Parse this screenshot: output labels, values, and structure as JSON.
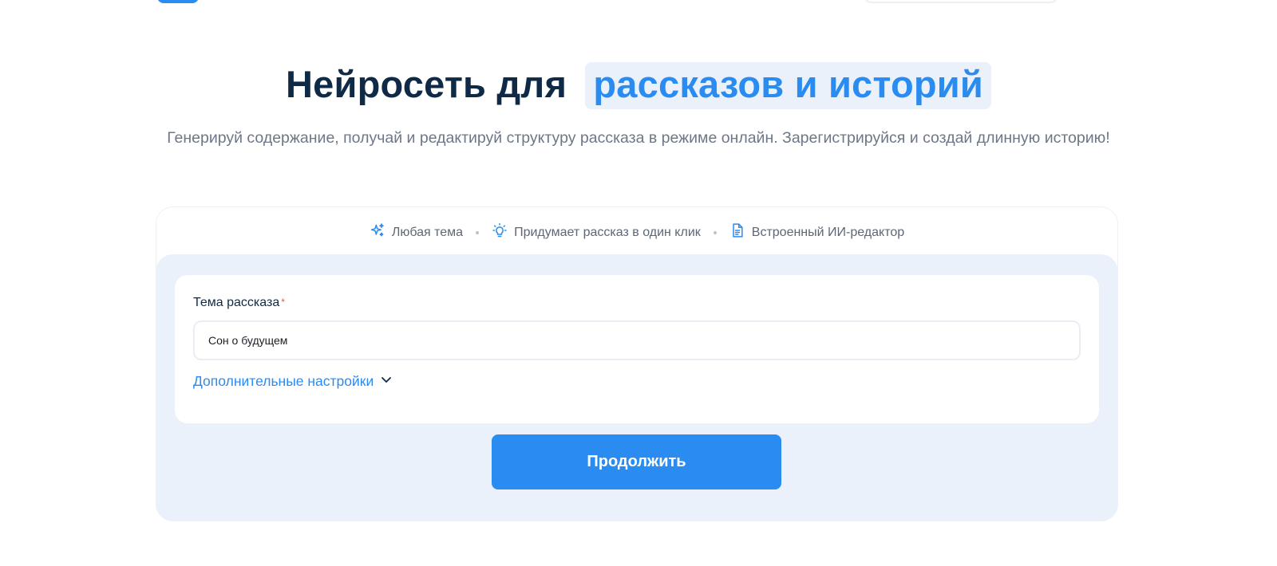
{
  "hero": {
    "title_main": "Нейросеть для",
    "title_accent": "рассказов и историй",
    "subtitle": "Генерируй содержание, получай и редактируй структуру рассказа в режиме онлайн. Зарегистрируйся и создай длинную историю!"
  },
  "features": [
    {
      "icon": "sparkles-icon",
      "label": "Любая тема"
    },
    {
      "icon": "lightbulb-icon",
      "label": "Придумает рассказ в один клик"
    },
    {
      "icon": "document-icon",
      "label": "Встроенный ИИ-редактор"
    }
  ],
  "form": {
    "topic_label": "Тема рассказа",
    "required_mark": "*",
    "topic_value": "Сон о будущем",
    "more_settings_label": "Дополнительные настройки",
    "submit_label": "Продолжить"
  },
  "colors": {
    "accent": "#2a8cf0",
    "title": "#0e2a47",
    "panel": "#eaf1fb"
  }
}
